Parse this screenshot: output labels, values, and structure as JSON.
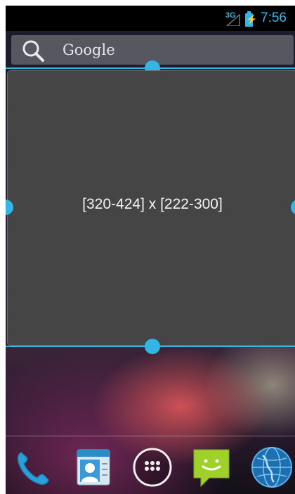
{
  "status_bar": {
    "network_type": "3G",
    "time": "7:56"
  },
  "search_bar": {
    "label": "Google",
    "icon": "search-icon"
  },
  "widget": {
    "dimension_text": "[320-424] x [222-300]"
  },
  "dock": {
    "items": [
      {
        "name": "phone",
        "icon": "phone-icon"
      },
      {
        "name": "contacts",
        "icon": "contacts-icon"
      },
      {
        "name": "all-apps",
        "icon": "apps-grid-icon"
      },
      {
        "name": "messaging",
        "icon": "message-icon"
      },
      {
        "name": "browser",
        "icon": "globe-icon"
      }
    ]
  },
  "colors": {
    "accent": "#33b5e5",
    "widget_bg": "#454545"
  }
}
